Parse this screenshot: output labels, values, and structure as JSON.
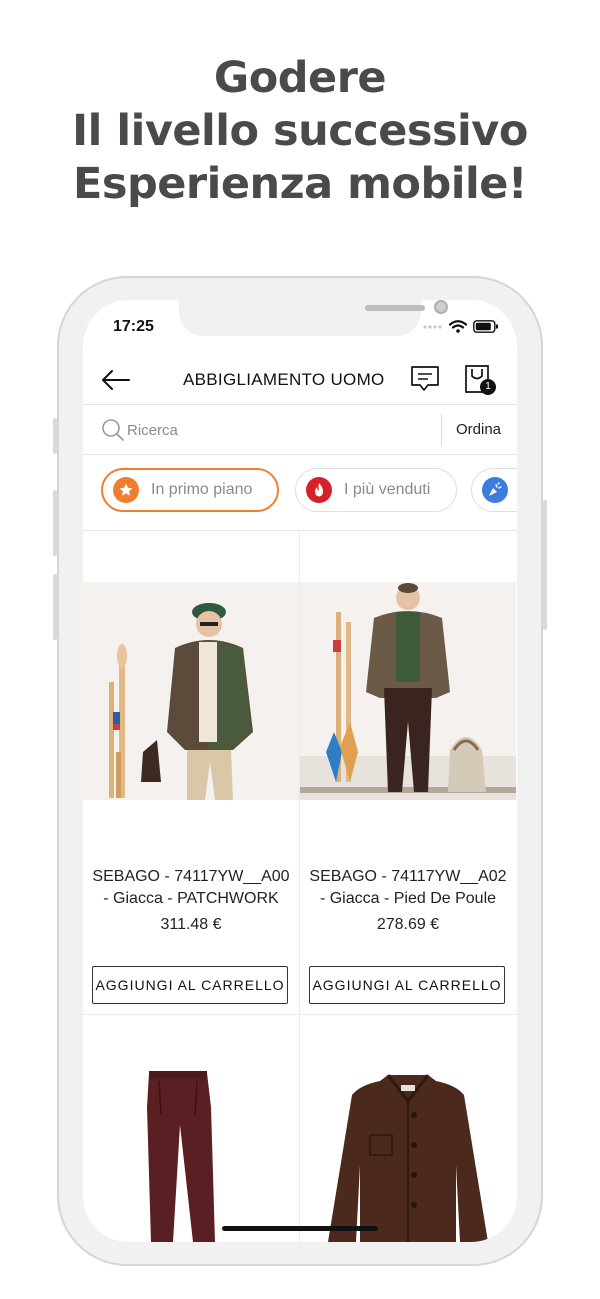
{
  "headline": {
    "line1": "Godere",
    "line2": "Il livello successivo",
    "line3": "Esperienza mobile!"
  },
  "status_bar": {
    "time": "17:25",
    "icons": [
      "signal-icon",
      "wifi-icon",
      "battery-icon"
    ]
  },
  "app_bar": {
    "back_icon": "back-arrow-icon",
    "title": "ABBIGLIAMENTO UOMO",
    "messages_icon": "message-icon",
    "cart_icon": "shopping-bag-icon",
    "cart_badge": "1"
  },
  "search": {
    "placeholder": "Ricerca",
    "icon": "search-icon",
    "sort_label": "Ordina"
  },
  "chips": [
    {
      "label": "In primo piano",
      "icon": "star-icon",
      "color": "#ef7f2d",
      "active": true
    },
    {
      "label": "I più venduti",
      "icon": "flame-icon",
      "color": "#d6202a",
      "active": false
    },
    {
      "label": "",
      "icon": "party-popper-icon",
      "color": "#3b7ddd",
      "active": false
    }
  ],
  "products": [
    {
      "name": "SEBAGO - 74117YW__A00 - Giacca - PATCHWORK",
      "price": "311.48 €",
      "button_label": "AGGIUNGI AL CARRELLO"
    },
    {
      "name": "SEBAGO - 74117YW__A02 - Giacca - Pied De Poule",
      "price": "278.69 €",
      "button_label": "AGGIUNGI AL CARRELLO"
    }
  ],
  "colors": {
    "accent": "#ef7f2d",
    "headline": "#4a4a4a"
  }
}
